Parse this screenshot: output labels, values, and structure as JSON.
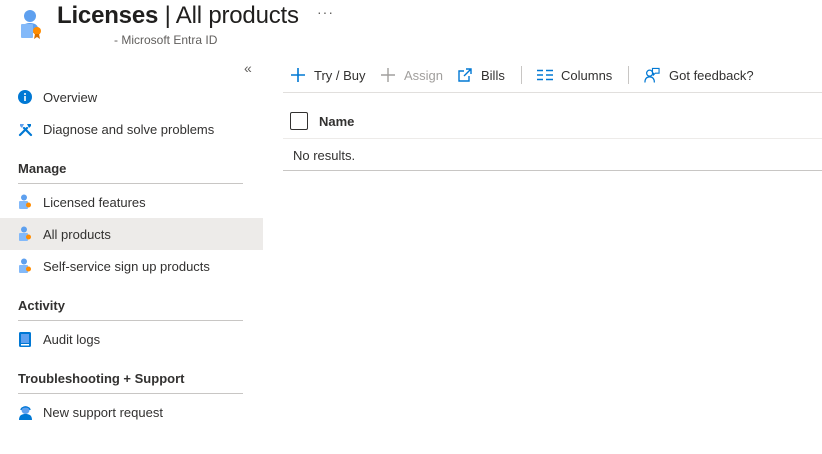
{
  "header": {
    "title_bold": "Licenses",
    "title_separator": " | ",
    "title_rest": "All products",
    "more_label": "···",
    "subtitle": "- Microsoft Entra ID",
    "icon": "licenses-icon"
  },
  "sidebar": {
    "collapse_label": "«",
    "items_top": [
      {
        "label": "Overview",
        "icon": "info-icon"
      },
      {
        "label": "Diagnose and solve problems",
        "icon": "wrench-icon"
      }
    ],
    "sections": [
      {
        "title": "Manage",
        "items": [
          {
            "label": "Licensed features",
            "icon": "license-user-icon"
          },
          {
            "label": "All products",
            "icon": "license-user-icon",
            "selected": true
          },
          {
            "label": "Self-service sign up products",
            "icon": "license-user-icon"
          }
        ]
      },
      {
        "title": "Activity",
        "items": [
          {
            "label": "Audit logs",
            "icon": "book-icon"
          }
        ]
      },
      {
        "title": "Troubleshooting + Support",
        "items": [
          {
            "label": "New support request",
            "icon": "support-person-icon"
          }
        ]
      }
    ]
  },
  "toolbar": {
    "try_buy": "Try / Buy",
    "assign": "Assign",
    "bills": "Bills",
    "columns": "Columns",
    "feedback": "Got feedback?"
  },
  "grid": {
    "columns": [
      "Name"
    ],
    "empty_message": "No results."
  },
  "colors": {
    "accent": "#0078d4",
    "selected_bg": "#edebe9",
    "text": "#323130",
    "disabled": "#a19f9d"
  }
}
